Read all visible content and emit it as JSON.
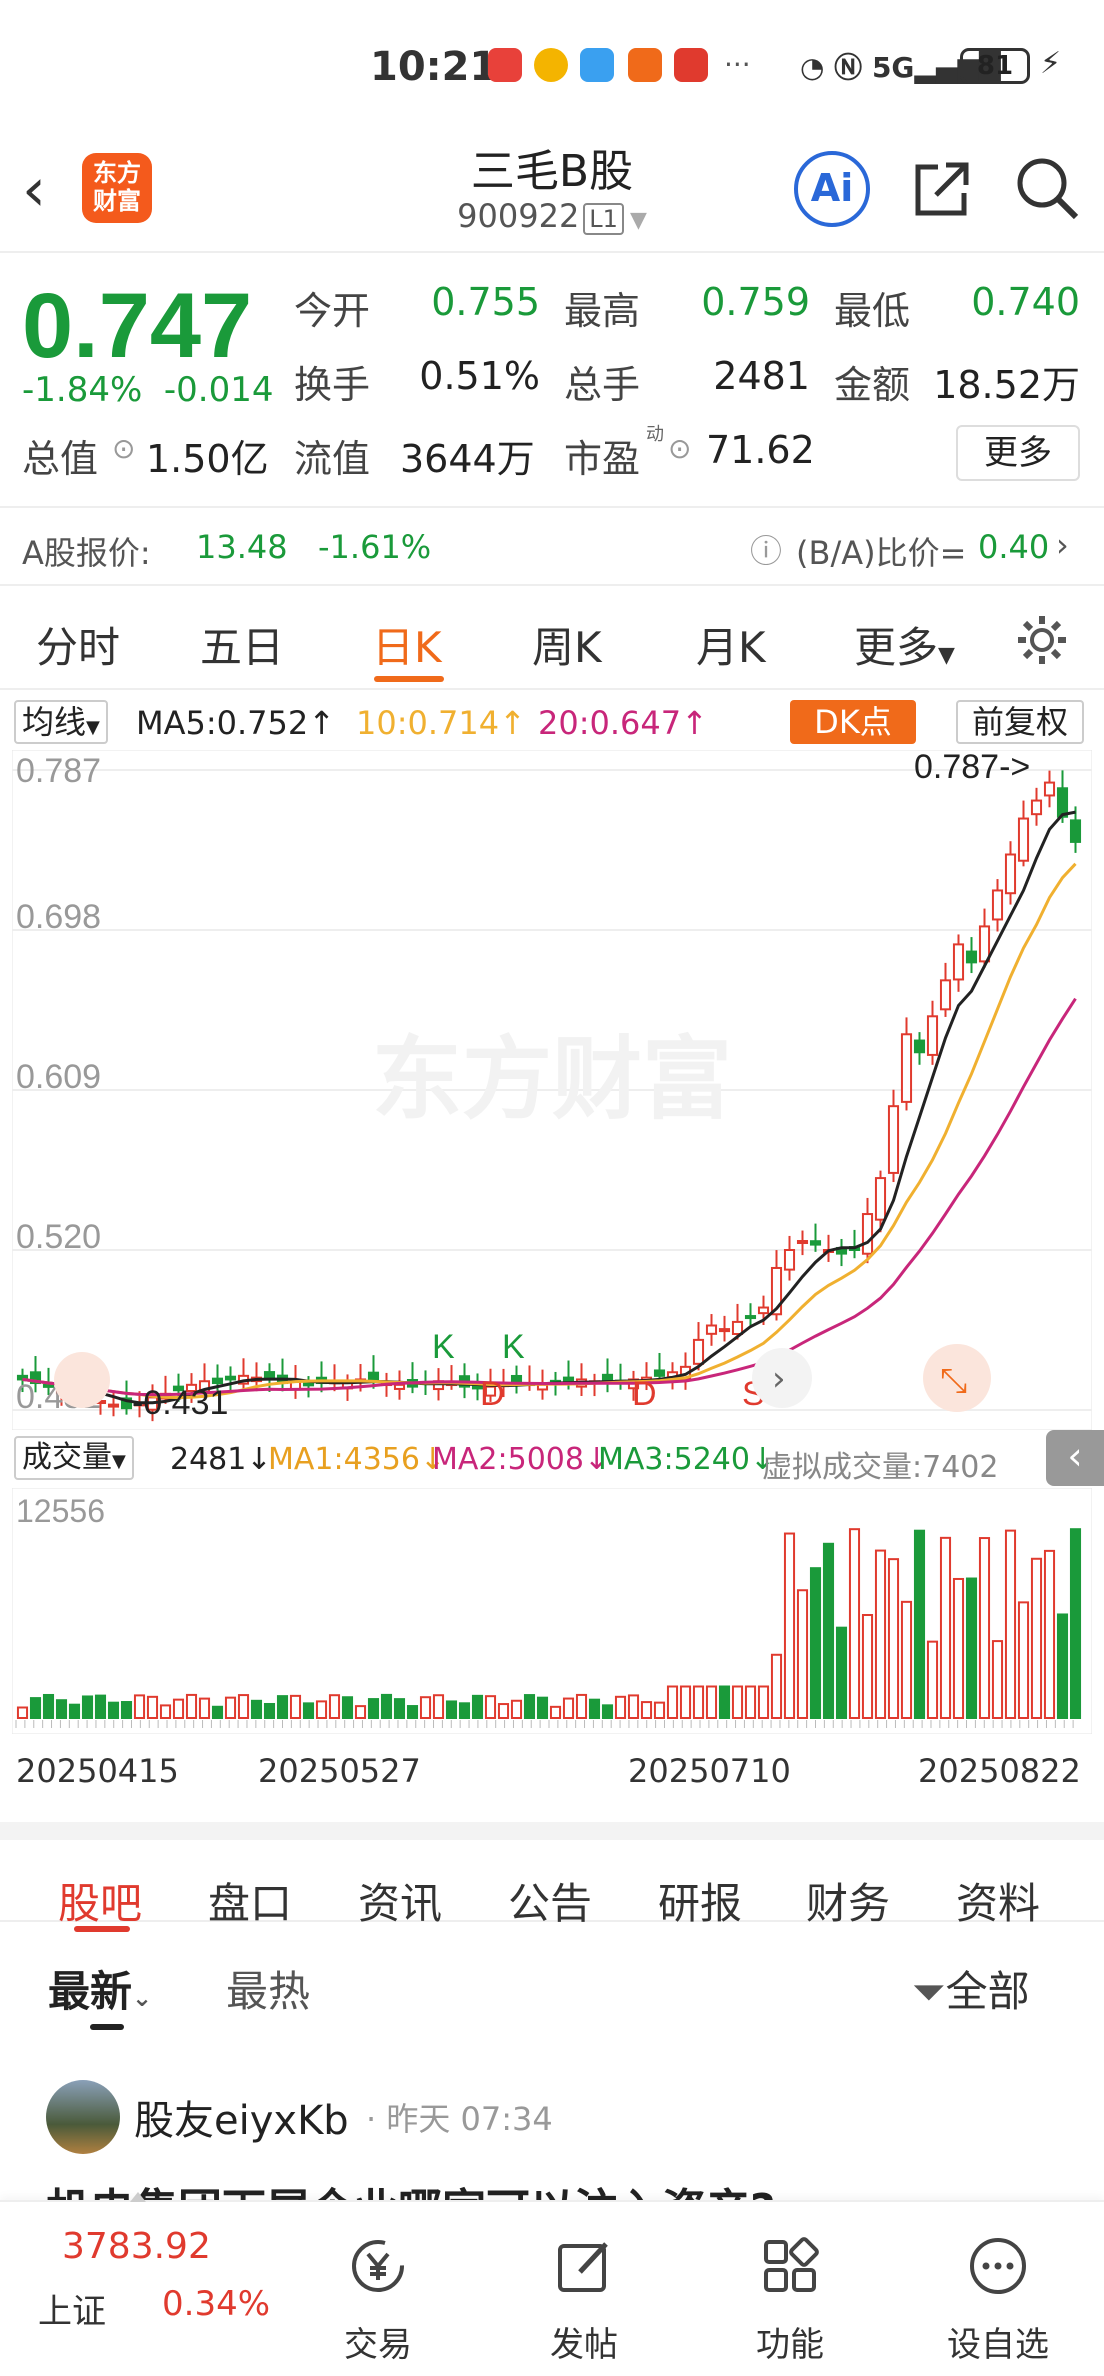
{
  "status": {
    "time": "10:21",
    "signal": "5G",
    "battery": "81"
  },
  "header": {
    "title": "三毛B股",
    "code": "900922",
    "level": "L1",
    "logo_text": "东方财富",
    "ai_label": "Ai"
  },
  "quote": {
    "price": "0.747",
    "change_pct": "-1.84%",
    "change": "-0.014",
    "rows": [
      [
        {
          "label": "今开",
          "value": "0.755",
          "color": "green"
        },
        {
          "label": "最高",
          "value": "0.759",
          "color": "green"
        },
        {
          "label": "最低",
          "value": "0.740",
          "color": "green"
        }
      ],
      [
        {
          "label": "换手",
          "value": "0.51%",
          "color": "black"
        },
        {
          "label": "总手",
          "value": "2481",
          "color": "black"
        },
        {
          "label": "金额",
          "value": "18.52万",
          "color": "black"
        }
      ]
    ],
    "row3": {
      "zongzhi_label": "总值",
      "zongzhi": "1.50亿",
      "liuzhi_label": "流值",
      "liuzhi": "3644万",
      "shiying_label": "市盈",
      "shiying_sup": "动",
      "shiying": "71.62"
    },
    "more": "更多"
  },
  "ashare": {
    "label": "A股报价:",
    "price": "13.48",
    "pct": "-1.61%",
    "ratio_label": "(B/A)比价=",
    "ratio": "0.40"
  },
  "tabs": [
    "分时",
    "五日",
    "日K",
    "周K",
    "月K",
    "更多"
  ],
  "ma": {
    "type": "均线",
    "ma5": "MA5:0.752↑",
    "ma10": "10:0.714↑",
    "ma20": "20:0.647↑",
    "dk": "DK点",
    "fq": "前复权"
  },
  "chart_data": {
    "type": "candlestick",
    "y_ticks": [
      "0.787",
      "0.698",
      "0.609",
      "0.520",
      "0.431"
    ],
    "ylim": [
      0.431,
      0.787
    ],
    "high_label": "0.787->",
    "low_label": "-0.431",
    "markers": [
      "K",
      "K",
      "D",
      "D",
      "S"
    ],
    "watermark": "东方财富",
    "x_ticks": [
      "20250415",
      "20250527",
      "20250710",
      "20250822"
    ],
    "close": [
      0.448,
      0.446,
      0.444,
      0.443,
      0.441,
      0.438,
      0.436,
      0.434,
      0.432,
      0.435,
      0.438,
      0.44,
      0.442,
      0.445,
      0.447,
      0.446,
      0.448,
      0.45,
      0.449,
      0.448,
      0.446,
      0.447,
      0.445,
      0.446,
      0.447,
      0.446,
      0.448,
      0.447,
      0.446,
      0.445,
      0.444,
      0.446,
      0.447,
      0.446,
      0.444,
      0.443,
      0.444,
      0.446,
      0.447,
      0.446,
      0.445,
      0.446,
      0.447,
      0.448,
      0.447,
      0.446,
      0.447,
      0.448,
      0.449,
      0.45,
      0.452,
      0.455,
      0.47,
      0.478,
      0.476,
      0.48,
      0.483,
      0.488,
      0.51,
      0.52,
      0.525,
      0.523,
      0.52,
      0.518,
      0.52,
      0.54,
      0.56,
      0.6,
      0.64,
      0.63,
      0.65,
      0.67,
      0.69,
      0.68,
      0.7,
      0.72,
      0.74,
      0.76,
      0.77,
      0.78,
      0.761,
      0.747
    ]
  },
  "volume": {
    "label": "成交量",
    "cur": "2481↓",
    "ma1": "MA1:4356↓",
    "ma2": "MA2:5008↓",
    "ma3": "MA3:5240↓",
    "virtual": "虚拟成交量:7402",
    "max": "12556"
  },
  "bottom_tabs": [
    "股吧",
    "盘口",
    "资讯",
    "公告",
    "研报",
    "财务",
    "资料"
  ],
  "filter": {
    "latest": "最新",
    "hot": "最热",
    "all": "全部"
  },
  "post": {
    "user": "股友eiyxKb",
    "time": "· 昨天 07:34",
    "title": "机电集团下属企业哪家可以注入资产?"
  },
  "footer": {
    "index_name": "上证",
    "index_value": "3783.92",
    "index_pct": "0.34%",
    "items": [
      "交易",
      "发帖",
      "功能",
      "设自选"
    ]
  }
}
